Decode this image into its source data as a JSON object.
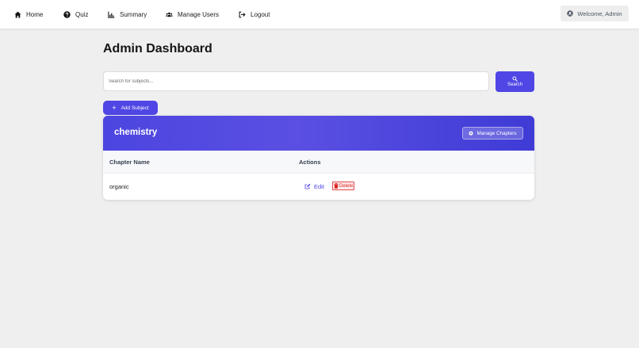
{
  "colors": {
    "accent": "#4f46e5",
    "background": "#efefef",
    "delete": "#dc2626"
  },
  "navbar": {
    "items": [
      {
        "label": "Home",
        "icon": "home-icon"
      },
      {
        "label": "Quiz",
        "icon": "question-circle-icon"
      },
      {
        "label": "Summary",
        "icon": "chart-bar-icon"
      },
      {
        "label": "Manage Users",
        "icon": "users-icon"
      },
      {
        "label": "Logout",
        "icon": "sign-out-icon"
      }
    ],
    "welcome": {
      "label": "Welcome, Admin",
      "icon": "user-circle-icon"
    }
  },
  "page": {
    "title": "Admin Dashboard"
  },
  "search": {
    "placeholder": "Search for subjects...",
    "value": "",
    "button_label": "Search",
    "button_icon": "search-icon"
  },
  "add_subject": {
    "label": "Add Subject",
    "icon": "plus-icon"
  },
  "subject_card": {
    "name": "chemistry",
    "manage_button": {
      "label": "Manage Chapters",
      "icon": "gear-icon"
    },
    "columns": [
      "Chapter Name",
      "Actions"
    ],
    "rows": [
      {
        "chapter": "organic",
        "edit_label": "Edit",
        "delete_label": "Delete"
      }
    ]
  }
}
